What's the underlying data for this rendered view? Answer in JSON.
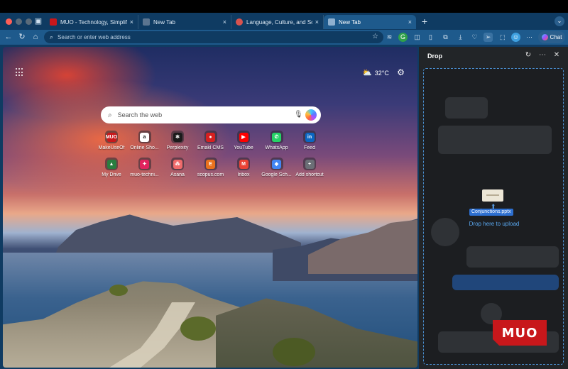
{
  "tabs": [
    {
      "title": "MUO - Technology, Simplified.",
      "favicon_color": "#c8171b",
      "favicon_text": "MUO",
      "active": false
    },
    {
      "title": "New Tab",
      "favicon_color": "#5c7590",
      "active": false
    },
    {
      "title": "Language, Culture, and Society",
      "favicon_color": "#d9534f",
      "active": false
    },
    {
      "title": "New Tab",
      "favicon_color": "#5c7590",
      "active": true
    }
  ],
  "tab_close_glyph": "×",
  "new_tab_glyph": "+",
  "address_bar": {
    "placeholder": "Search or enter web address"
  },
  "toolbar": {
    "chat_label": "Chat"
  },
  "newtab_page": {
    "weather": {
      "temperature": "32°C",
      "icon": "partly-cloudy-icon"
    },
    "search": {
      "placeholder": "Search the web"
    },
    "shortcuts": [
      {
        "label": "MakeUseOf",
        "color": "#c8171b",
        "glyph": "MUO"
      },
      {
        "label": "Online Sho...",
        "color": "#ffffff",
        "glyph": "a"
      },
      {
        "label": "Perplexity",
        "color": "#1b1b1b",
        "glyph": "✻"
      },
      {
        "label": "Emakl CMS",
        "color": "#d62020",
        "glyph": "●"
      },
      {
        "label": "YouTube",
        "color": "#ff0000",
        "glyph": "▶"
      },
      {
        "label": "WhatsApp",
        "color": "#25d366",
        "glyph": "✆"
      },
      {
        "label": "Feed",
        "color": "#0a66c2",
        "glyph": "in"
      },
      {
        "label": "My Drive",
        "color": "#2a7d3f",
        "glyph": "▲"
      },
      {
        "label": "muo-techni...",
        "color": "#e0245e",
        "glyph": "✦"
      },
      {
        "label": "Asana",
        "color": "#f06a6a",
        "glyph": "⁂"
      },
      {
        "label": "scopus.com",
        "color": "#e9711c",
        "glyph": "E"
      },
      {
        "label": "Inbox",
        "color": "#ea4335",
        "glyph": "M"
      },
      {
        "label": "Google Sch...",
        "color": "#4285f4",
        "glyph": "◆"
      },
      {
        "label": "Add shortcut",
        "color": "#6b6f76",
        "glyph": "+"
      }
    ]
  },
  "drop_panel": {
    "title": "Drop",
    "file_name": "Conjunctions.pptx",
    "hint": "Drop here to upload"
  },
  "watermark": "MUO"
}
